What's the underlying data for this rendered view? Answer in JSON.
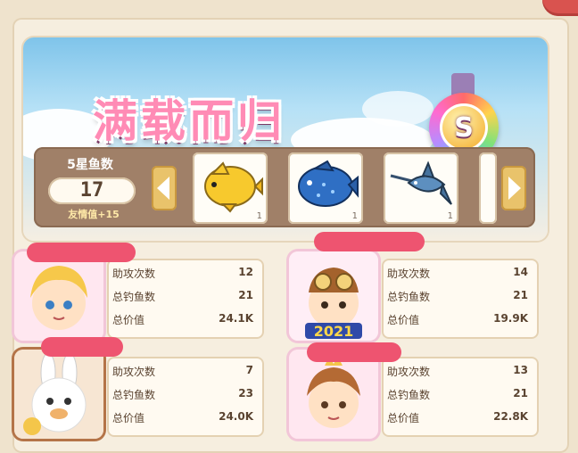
{
  "banner": {
    "title": "满载而归",
    "medal_letter": "S"
  },
  "stats": {
    "label": "5星鱼数",
    "count": "17",
    "friendship": "友情值+15"
  },
  "fish": [
    {
      "name": "butterflyfish-icon",
      "count": "1"
    },
    {
      "name": "blue-fish-icon",
      "count": "1"
    },
    {
      "name": "swordfish-icon",
      "count": "1"
    }
  ],
  "players": [
    {
      "assist_label": "助攻次数",
      "assist": "12",
      "catch_label": "总钓鱼数",
      "catch": "21",
      "value_label": "总价值",
      "value": "24.1K"
    },
    {
      "assist_label": "助攻次数",
      "assist": "14",
      "catch_label": "总钓鱼数",
      "catch": "21",
      "value_label": "总价值",
      "value": "19.9K"
    },
    {
      "assist_label": "助攻次数",
      "assist": "7",
      "catch_label": "总钓鱼数",
      "catch": "23",
      "value_label": "总价值",
      "value": "24.0K"
    },
    {
      "assist_label": "助攻次数",
      "assist": "13",
      "catch_label": "总钓鱼数",
      "catch": "21",
      "value_label": "总价值",
      "value": "22.8K"
    }
  ],
  "avatar_badge": "2021",
  "colors": {
    "redaction": "#ee5470",
    "accent_pink": "#ff8bb5",
    "strip_brown": "#a08068"
  }
}
